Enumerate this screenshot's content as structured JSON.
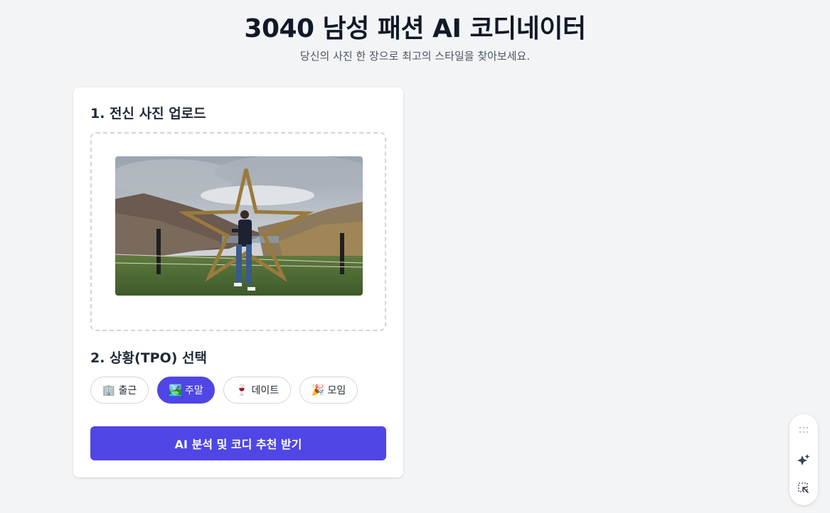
{
  "header": {
    "title": "3040 남성 패션 AI 코디네이터",
    "subtitle": "당신의 사진 한 장으로 최고의 스타일을 찾아보세요."
  },
  "upload": {
    "section_title": "1. 전신 사진 업로드"
  },
  "tpo": {
    "section_title": "2. 상황(TPO) 선택",
    "options": [
      {
        "icon": "🏢",
        "icon_name": "office-building-icon",
        "label": "출근",
        "selected": false
      },
      {
        "icon": "🏞️",
        "icon_name": "landscape-icon",
        "label": "주말",
        "selected": true
      },
      {
        "icon": "🍷",
        "icon_name": "wine-glass-icon",
        "label": "데이트",
        "selected": false
      },
      {
        "icon": "🎉",
        "icon_name": "party-popper-icon",
        "label": "모임",
        "selected": false
      }
    ]
  },
  "cta": {
    "label": "AI 분석 및 코디 추천 받기"
  },
  "colors": {
    "accent": "#4f46e5",
    "background": "#f3f4f6",
    "card": "#ffffff"
  },
  "floating_toolbar": {
    "icons": [
      "drag-handle-icon",
      "sparkle-icon",
      "select-element-icon"
    ]
  }
}
